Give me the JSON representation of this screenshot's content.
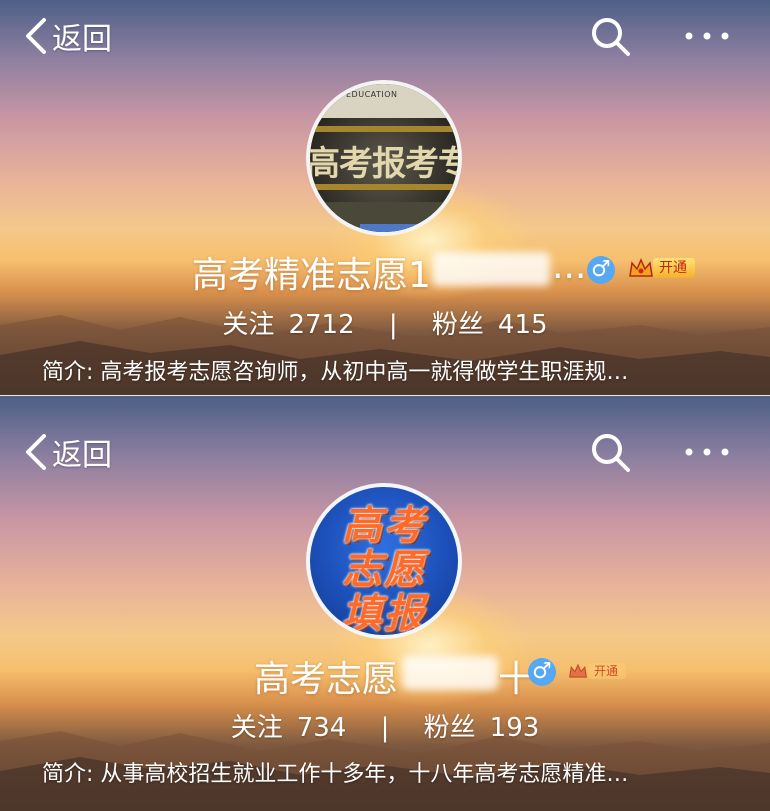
{
  "profiles": [
    {
      "back_label": "返回",
      "name": "高考精准志愿1",
      "name_trail": "...",
      "vip_label": "开通",
      "following_label": "关注",
      "following_count": "2712",
      "separator": "|",
      "followers_label": "粉丝",
      "followers_count": "415",
      "bio": "简介: 高考报考志愿咨询师，从初中高一就得做学生职涯规…",
      "avatar_small_text": "EDUCATION",
      "avatar_big_text": "高考报考专"
    },
    {
      "back_label": "返回",
      "name": "高考志愿",
      "name_trail": "十",
      "vip_label": "开通",
      "following_label": "关注",
      "following_count": "734",
      "separator": "|",
      "followers_label": "粉丝",
      "followers_count": "193",
      "bio": "简介: 从事高校招生就业工作十多年，十八年高考志愿精准…",
      "avatar_lines": [
        "高考",
        "志愿",
        "填报"
      ]
    }
  ],
  "colors": {
    "gender_badge": "#56a8f2",
    "vip_text": "#c4260e",
    "vip_bg": "#f4b12c",
    "avatar2_text": "#ff6a2a",
    "avatar2_bg": "#1c4fb8"
  },
  "icons": {
    "back": "chevron-left-icon",
    "search": "search-icon",
    "more": "more-dots-icon",
    "gender": "male-icon",
    "vip": "crown-icon"
  }
}
